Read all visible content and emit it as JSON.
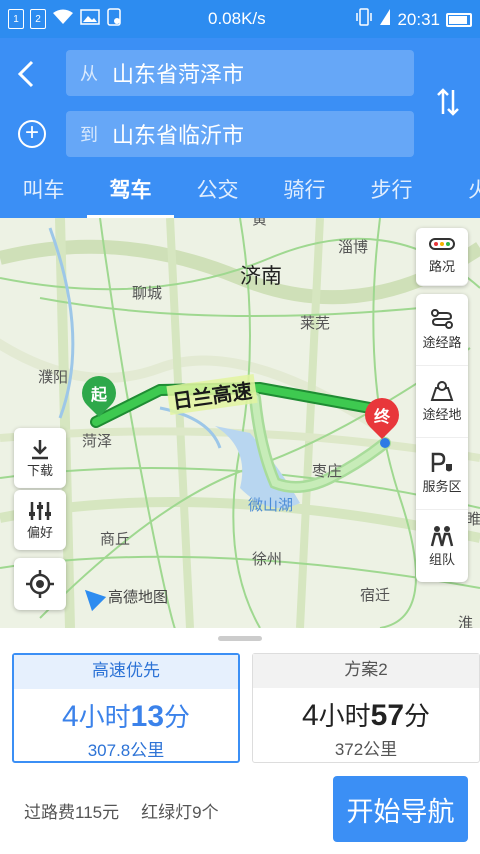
{
  "status_bar": {
    "sim1": "1",
    "sim2": "2",
    "speed": "0.08K/s",
    "time": "20:31"
  },
  "header": {
    "from_prefix": "从",
    "from_value": "山东省菏泽市",
    "to_prefix": "到",
    "to_value": "山东省临沂市"
  },
  "tabs": [
    "叫车",
    "驾车",
    "公交",
    "骑行",
    "步行",
    "火"
  ],
  "map": {
    "cities": {
      "jinan": "济南",
      "liaocheng": "聊城",
      "zibo": "淄博",
      "laiwu": "莱芜",
      "puyang": "濮阳",
      "heze": "菏泽",
      "zaozhuang": "枣庄",
      "shangqiu": "商丘",
      "xuzhou": "徐州",
      "suqian": "宿迁",
      "huai": "淮",
      "huang": "黄",
      "sui": "睢"
    },
    "route_label": "日兰高速",
    "lake_label": "微山湖",
    "start_marker": "起",
    "end_marker": "终",
    "logo_text": "高德地图",
    "right_tools": {
      "traffic": "路况",
      "waypoint_route": "途经路",
      "waypoint_place": "途经地",
      "service_area": "服务区",
      "team": "组队"
    },
    "left_tools": {
      "download": "下载",
      "preference": "偏好"
    }
  },
  "plans": [
    {
      "title": "高速优先",
      "hours": "4",
      "hour_unit": "小时",
      "minutes": "13",
      "minute_unit": "分",
      "distance": "307.8公里"
    },
    {
      "title": "方案2",
      "hours": "4",
      "hour_unit": "小时",
      "minutes": "57",
      "minute_unit": "分",
      "distance": "372公里"
    }
  ],
  "info": {
    "toll": "过路费115元",
    "lights": "红绿灯9个"
  },
  "start_nav_label": "开始导航",
  "colors": {
    "accent": "#3b8ff5",
    "route_green": "#2fb84a",
    "end_red": "#e8373b"
  }
}
